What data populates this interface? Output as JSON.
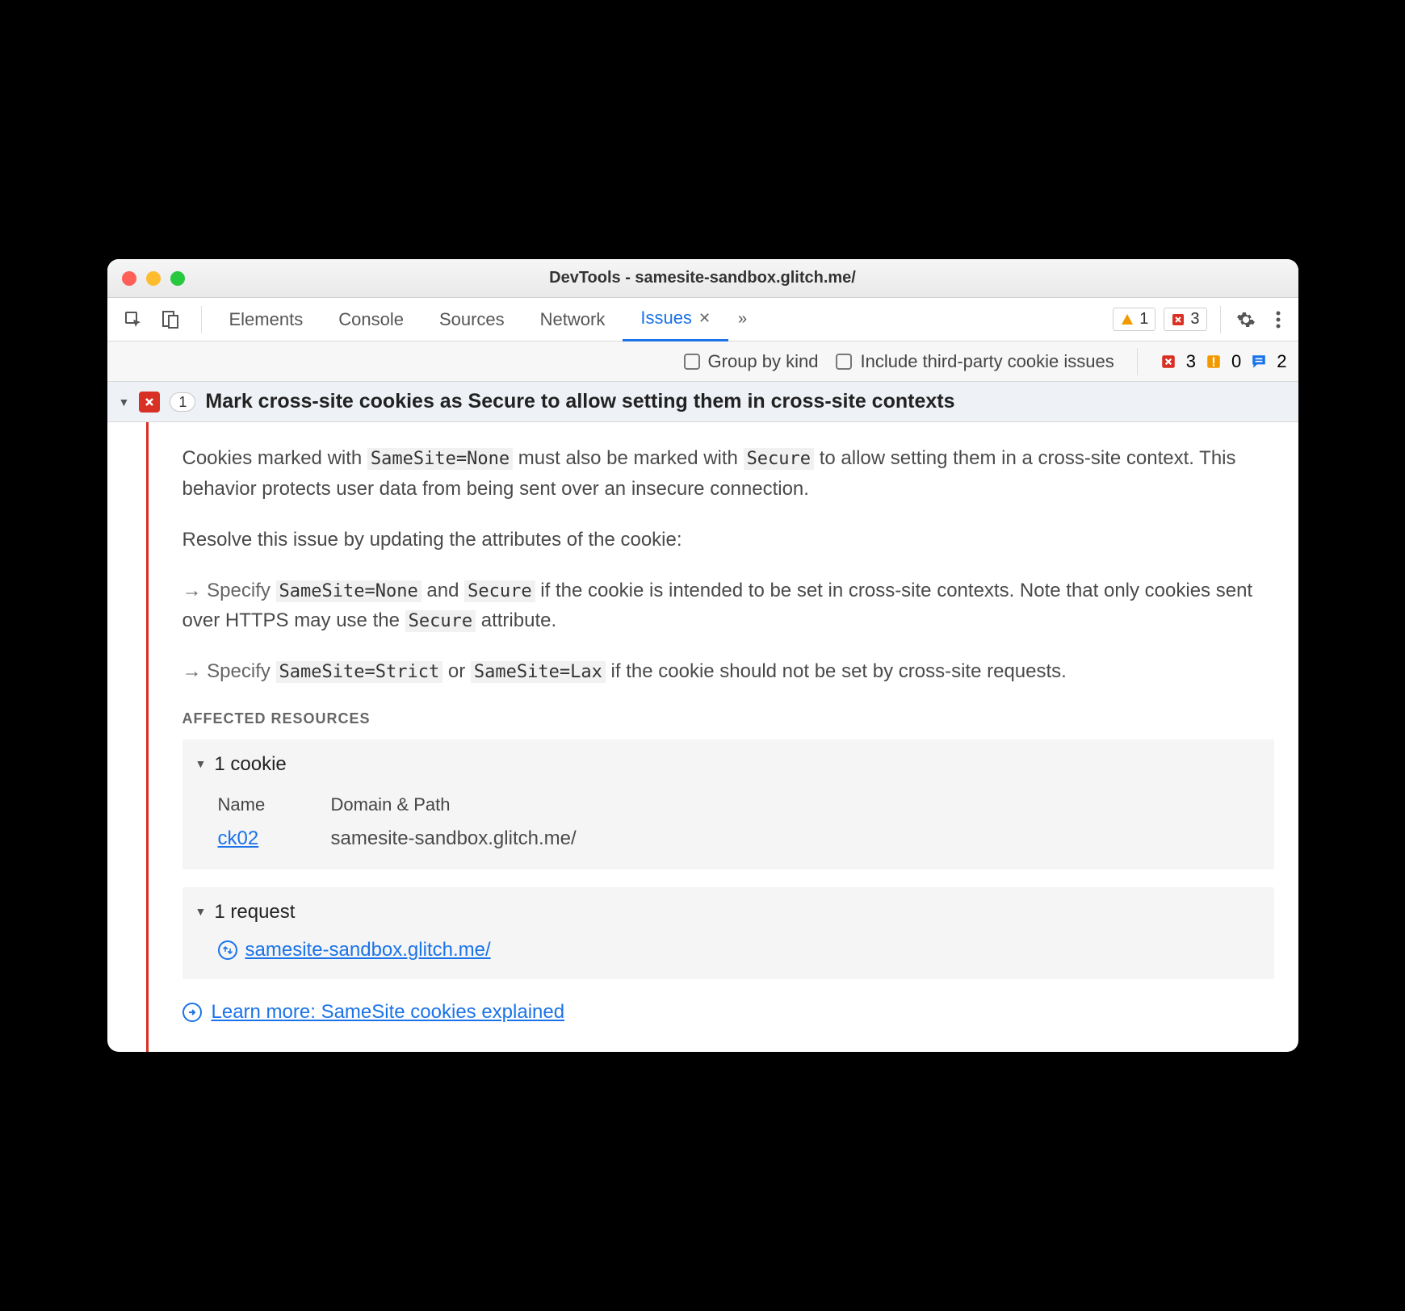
{
  "window": {
    "title": "DevTools - samesite-sandbox.glitch.me/"
  },
  "tabs": {
    "items": [
      "Elements",
      "Console",
      "Sources",
      "Network",
      "Issues"
    ],
    "active": "Issues"
  },
  "toolbar_counts": {
    "warnings": "1",
    "errors": "3"
  },
  "filterbar": {
    "group_by_kind": "Group by kind",
    "include_third_party": "Include third-party cookie issues",
    "errors": "3",
    "info": "0",
    "chat": "2"
  },
  "issue": {
    "count": "1",
    "title": "Mark cross-site cookies as Secure to allow setting them in cross-site contexts",
    "p1a": "Cookies marked with ",
    "p1_code1": "SameSite=None",
    "p1b": " must also be marked with ",
    "p1_code2": "Secure",
    "p1c": " to allow setting them in a cross-site context. This behavior protects user data from being sent over an insecure connection.",
    "p2": "Resolve this issue by updating the attributes of the cookie:",
    "b1a": "→ Specify ",
    "b1_code1": "SameSite=None",
    "b1b": " and ",
    "b1_code2": "Secure",
    "b1c": " if the cookie is intended to be set in cross-site contexts. Note that only cookies sent over HTTPS may use the ",
    "b1_code3": "Secure",
    "b1d": " attribute.",
    "b2a": "→ Specify ",
    "b2_code1": "SameSite=Strict",
    "b2b": " or ",
    "b2_code2": "SameSite=Lax",
    "b2c": " if the cookie should not be set by cross-site requests.",
    "affected_label": "AFFECTED RESOURCES",
    "cookie_head": "1 cookie",
    "col_name": "Name",
    "col_domain": "Domain & Path",
    "cookie_name": "ck02",
    "cookie_domain": "samesite-sandbox.glitch.me/",
    "request_head": "1 request",
    "request_url": "samesite-sandbox.glitch.me/",
    "learn_more": "Learn more: SameSite cookies explained"
  }
}
